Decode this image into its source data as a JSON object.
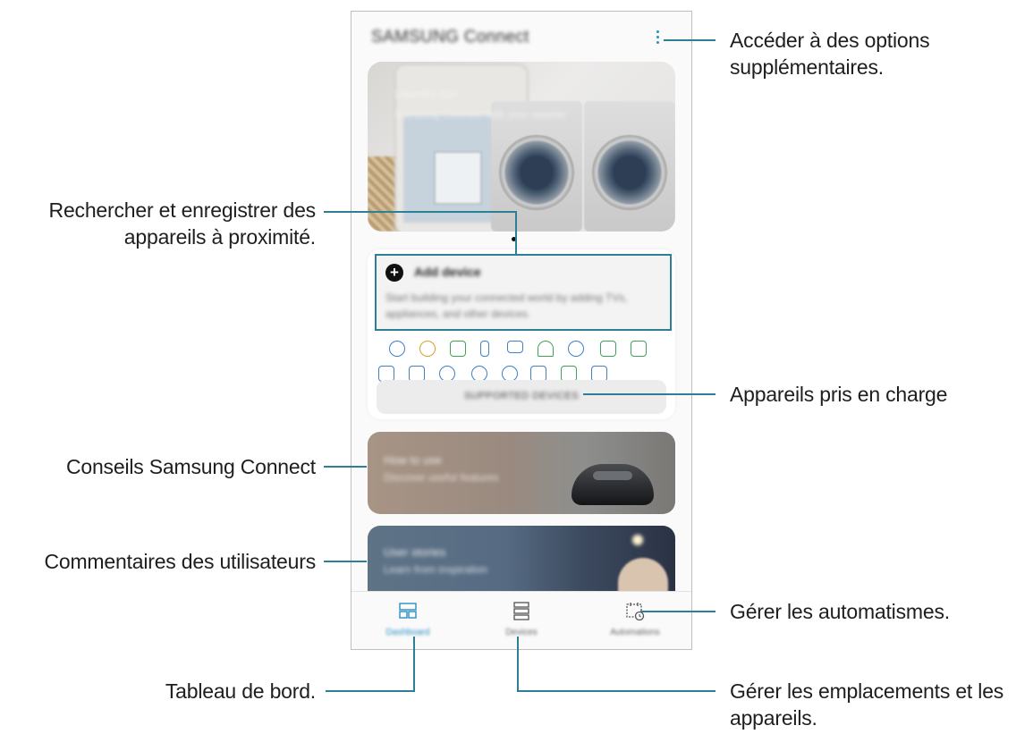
{
  "callouts": {
    "more_options": [
      "Accéder à des options",
      "supplémentaires."
    ],
    "search_devices": [
      "Rechercher et enregistrer des",
      "appareils à proximité."
    ],
    "supported_devices": "Appareils pris en charge",
    "tips": "Conseils Samsung Connect",
    "user_stories": "Commentaires des utilisateurs",
    "automations": "Gérer les automatismes.",
    "dashboard": "Tableau de bord.",
    "locations": [
      "Gérer les emplacements et les",
      "appareils."
    ]
  },
  "app": {
    "title": "SAMSUNG Connect",
    "more_icon": "more-vert-icon",
    "banner": {
      "line1": "Laundry tips",
      "line2": "Samsung Connect with your washer"
    },
    "add_device": {
      "title": "Add device",
      "description": "Start building your connected world by adding TVs, appliances, and other devices."
    },
    "supported_devices_button": "SUPPORTED DEVICES",
    "tips_card": {
      "title": "How to use",
      "subtitle": "Discover useful features"
    },
    "stories_card": {
      "title": "User stories",
      "subtitle": "Learn from inspiration"
    },
    "nav": [
      {
        "label": "Dashboard",
        "icon": "dashboard-icon",
        "active": true
      },
      {
        "label": "Devices",
        "icon": "devices-list-icon",
        "active": false
      },
      {
        "label": "Automations",
        "icon": "automation-calendar-icon",
        "active": false
      }
    ]
  },
  "colors": {
    "callout_line": "#2d7f96",
    "accent": "#2a8fc4"
  }
}
